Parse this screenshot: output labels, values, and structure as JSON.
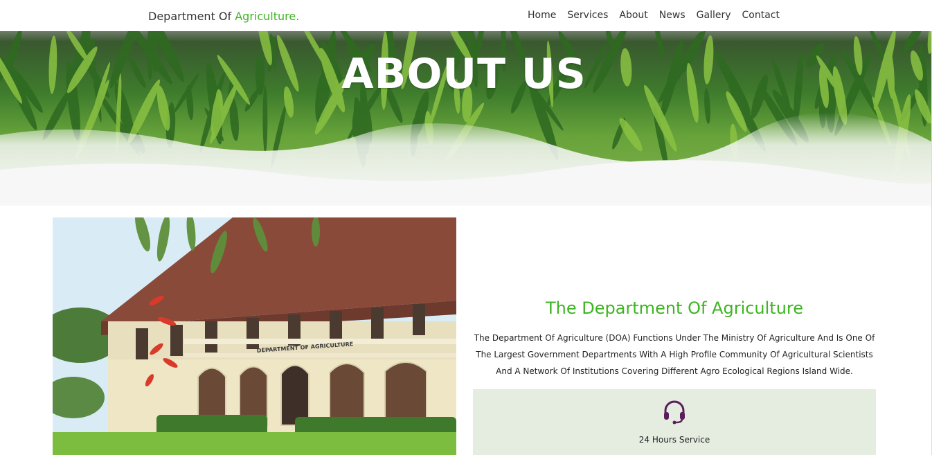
{
  "navbar": {
    "brand_prefix": "Department Of ",
    "brand_accent": "Agriculture.",
    "items": [
      {
        "label": "Home"
      },
      {
        "label": "Services"
      },
      {
        "label": "About"
      },
      {
        "label": "News"
      },
      {
        "label": "Gallery"
      },
      {
        "label": "Contact"
      }
    ]
  },
  "hero": {
    "title": "ABOUT US"
  },
  "photo": {
    "sign_text": "DEPARTMENT OF AGRICULTURE"
  },
  "about": {
    "heading": "The Department Of Agriculture",
    "lines": [
      "The Department Of Agriculture (DOA) Functions Under The Ministry Of Agriculture And Is One Of",
      "The Largest Government Departments With A High Profile Community Of Agricultural Scientists",
      "And A Network Of Institutions Covering Different Agro Ecological Regions Island Wide."
    ]
  },
  "service": {
    "icon": "headset-icon",
    "label": "24 Hours Service"
  },
  "colors": {
    "accent": "#3cb521",
    "service_bg": "#e4ede0",
    "icon": "#5a1f5a"
  }
}
